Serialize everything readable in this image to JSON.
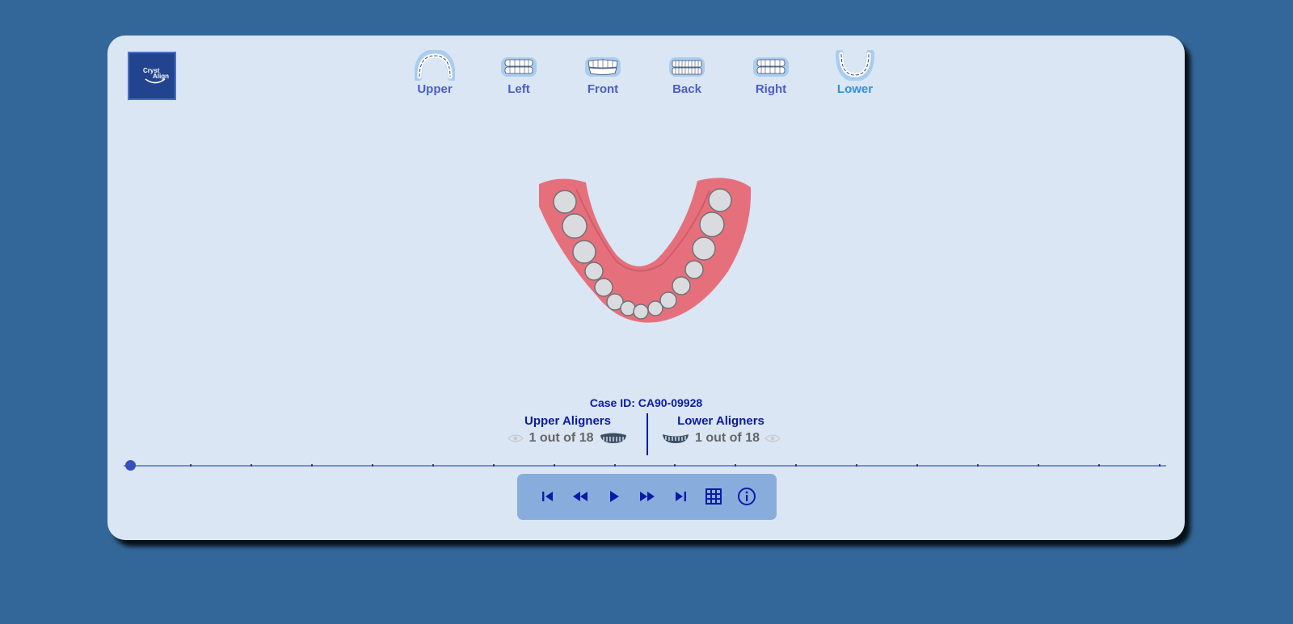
{
  "logo": {
    "line1": "Cryst",
    "line2": "Align"
  },
  "views": [
    {
      "label": "Upper",
      "icon": "upper-arch-icon"
    },
    {
      "label": "Left",
      "icon": "left-view-icon"
    },
    {
      "label": "Front",
      "icon": "front-view-icon"
    },
    {
      "label": "Back",
      "icon": "back-view-icon"
    },
    {
      "label": "Right",
      "icon": "right-view-icon"
    },
    {
      "label": "Lower",
      "icon": "lower-arch-icon",
      "active": true
    }
  ],
  "model": {
    "description_icon": "lower-jaw-3d-model"
  },
  "case": {
    "label": "Case ID: CA90-09928"
  },
  "upper_aligners": {
    "title": "Upper Aligners",
    "progress": "1 out of 18",
    "current": 1,
    "total": 18
  },
  "lower_aligners": {
    "title": "Lower Aligners",
    "progress": "1 out of 18",
    "current": 1,
    "total": 18
  },
  "timeline": {
    "steps": 18,
    "current_step": 1
  },
  "controls": [
    {
      "name": "first-step-button",
      "icon": "skip-start-icon"
    },
    {
      "name": "rewind-button",
      "icon": "rewind-icon"
    },
    {
      "name": "play-button",
      "icon": "play-icon"
    },
    {
      "name": "fast-forward-button",
      "icon": "fast-forward-icon"
    },
    {
      "name": "last-step-button",
      "icon": "skip-end-icon"
    },
    {
      "name": "grid-button",
      "icon": "grid-icon"
    },
    {
      "name": "info-button",
      "icon": "info-icon"
    }
  ],
  "colors": {
    "background": "#336799",
    "panel": "#dae6f3",
    "accent": "#0b1aa8",
    "active_tab": "#2f8fe0",
    "tab_label": "#4b5dc8",
    "controls_bar": "#88addd",
    "gum": "#e5707c"
  }
}
